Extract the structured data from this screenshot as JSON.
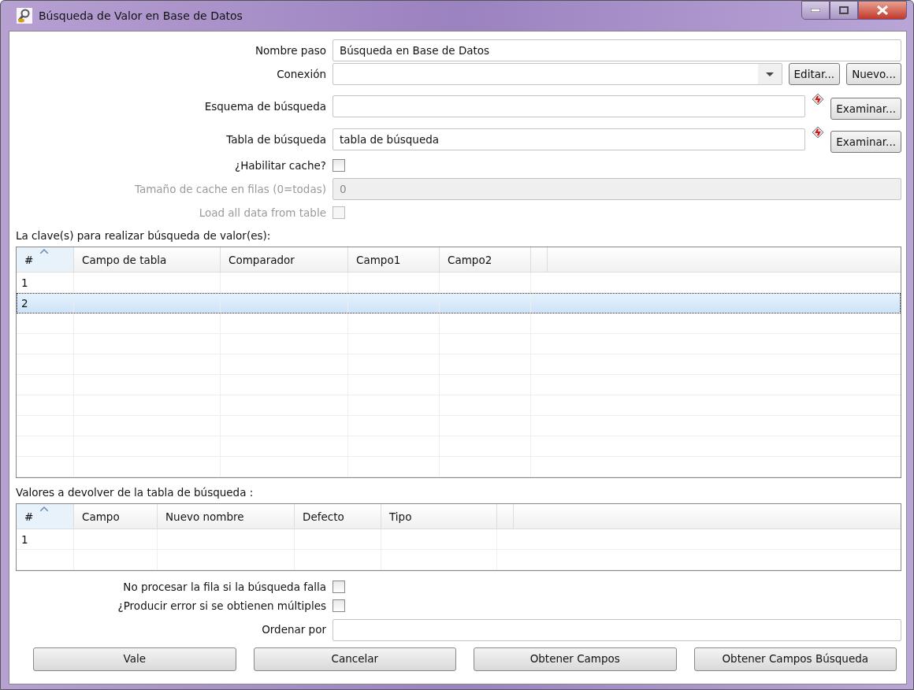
{
  "window": {
    "title": "Búsqueda de Valor en Base de Datos"
  },
  "form": [
    {
      "kind": "text",
      "label": "Nombre paso",
      "value": "Búsqueda en Base de Datos",
      "disabled": false
    },
    {
      "kind": "combo",
      "label": "Conexión",
      "buttons": [
        "Editar...",
        "Nuevo..."
      ]
    },
    {
      "kind": "browse",
      "label": "Esquema de búsqueda",
      "button": "Examinar..."
    },
    {
      "kind": "browse",
      "label": "Tabla de búsqueda",
      "value": "tabla de búsqueda",
      "button": "Examinar..."
    },
    {
      "kind": "check",
      "label": "¿Habilitar cache?",
      "checked": false,
      "disabled": false
    },
    {
      "kind": "text",
      "label": "Tamaño de cache en filas (0=todas)",
      "value": "0",
      "disabled": true
    },
    {
      "kind": "check",
      "label": "Load all data from table",
      "checked": false,
      "disabled": true
    }
  ],
  "keys_table": {
    "caption": "La clave(s) para realizar búsqueda de valor(es):",
    "columns": [
      "#",
      "Campo de tabla",
      "Comparador",
      "Campo1",
      "Campo2"
    ],
    "rows": [
      {
        "cells": [
          "1"
        ],
        "selected": false
      },
      {
        "cells": [
          "2"
        ],
        "selected": true
      }
    ]
  },
  "return_table": {
    "caption": "Valores a devolver de la tabla de búsqueda :",
    "columns": [
      "#",
      "Campo",
      "Nuevo nombre",
      "Defecto",
      "Tipo"
    ],
    "rows": [
      {
        "cells": [
          "1"
        ],
        "selected": false
      }
    ]
  },
  "options": [
    {
      "kind": "check",
      "label": "No procesar la fila si la búsqueda falla",
      "checked": false
    },
    {
      "kind": "check",
      "label": "¿Producir error si se obtienen múltiples",
      "checked": false
    },
    {
      "kind": "text",
      "label": "Ordenar por"
    }
  ],
  "buttons": [
    "Vale",
    "Cancelar",
    "Obtener Campos",
    "Obtener Campos Búsqueda"
  ]
}
